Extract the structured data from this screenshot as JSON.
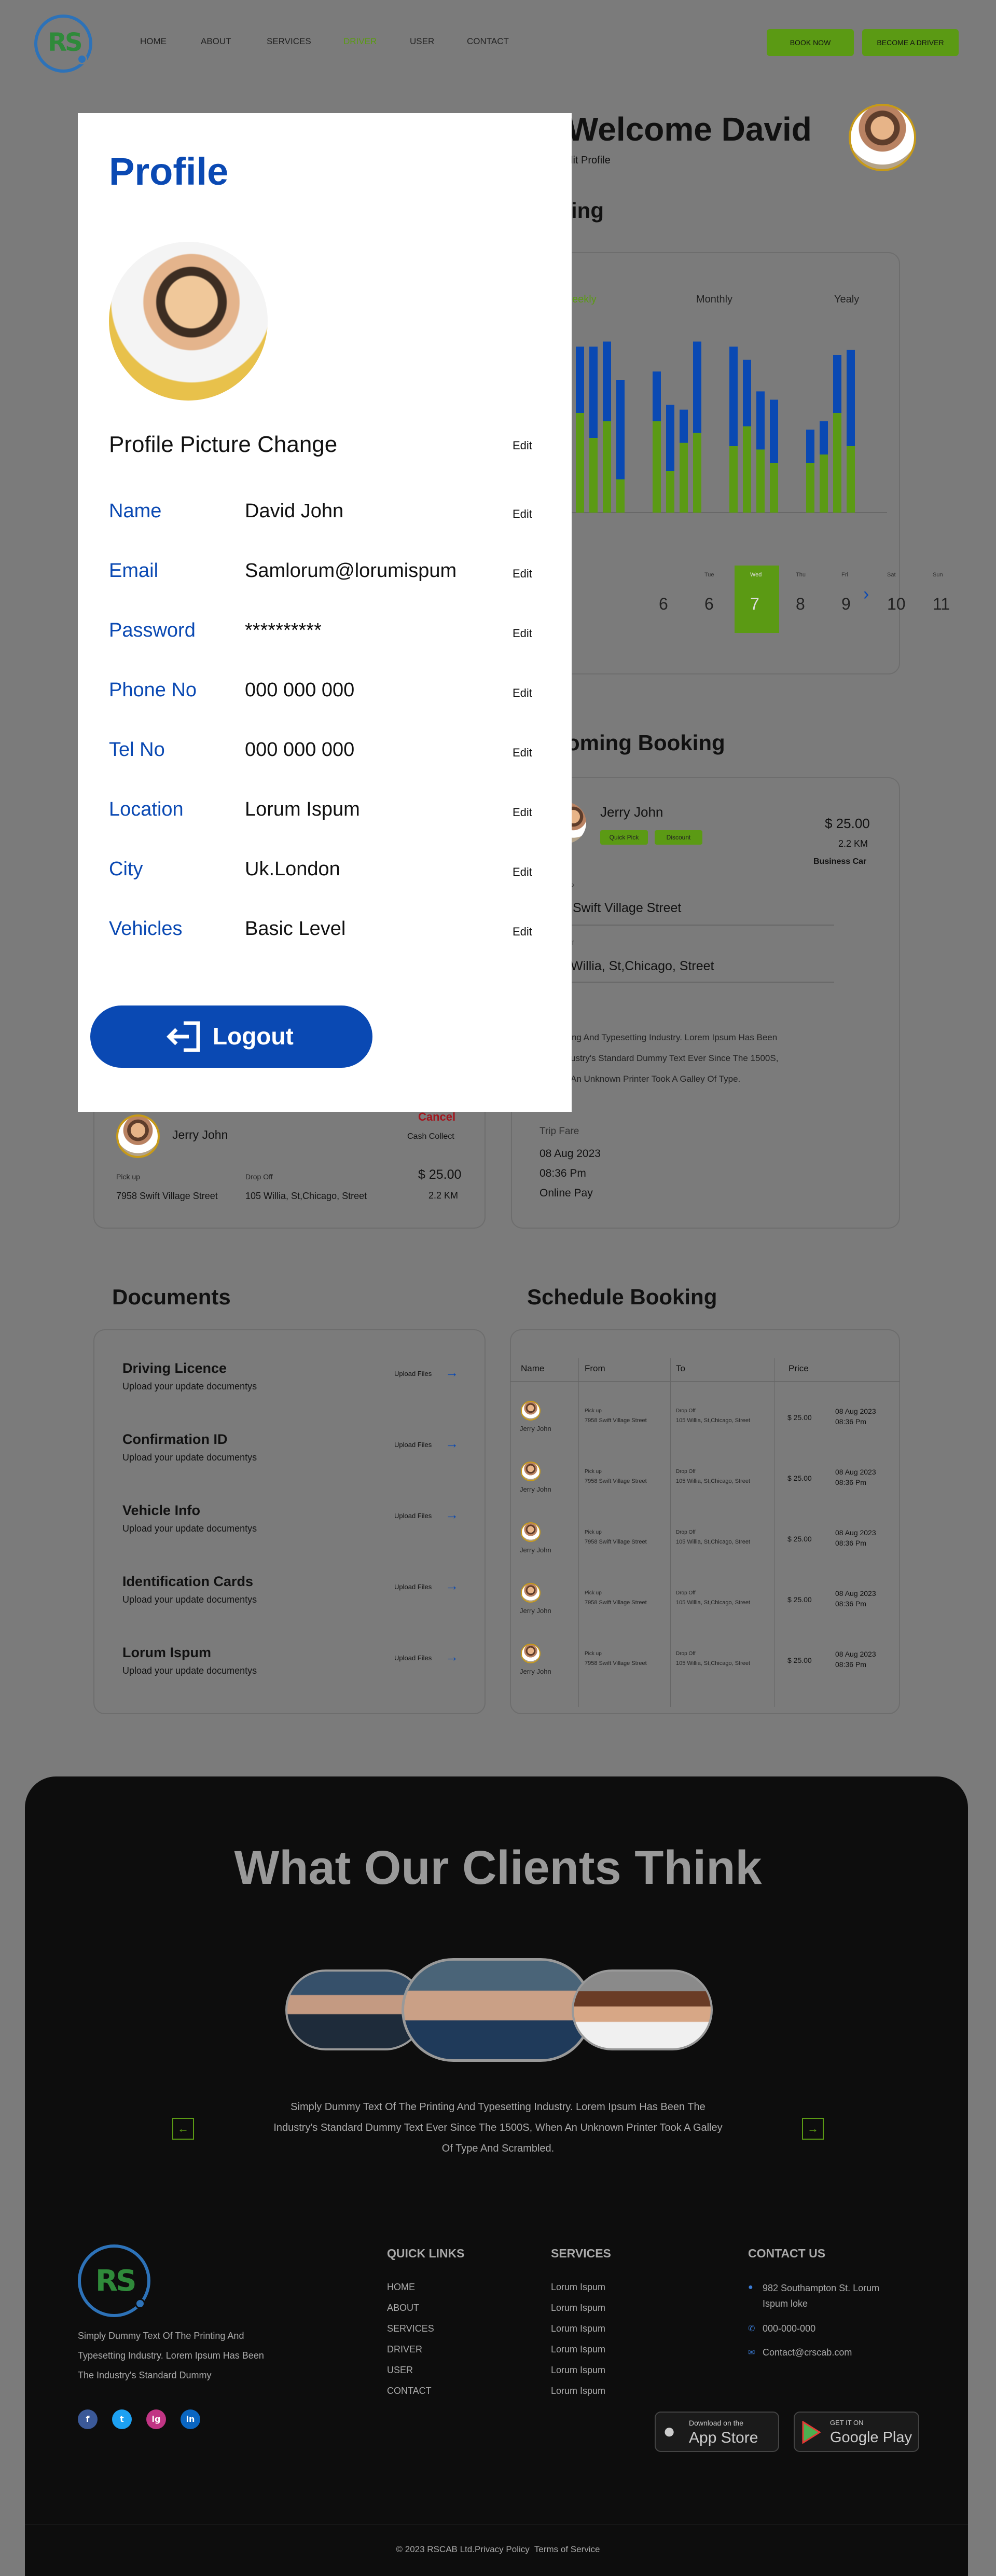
{
  "header": {
    "nav": [
      "HOME",
      "ABOUT",
      "SERVICES",
      "DRIVER",
      "USER",
      "CONTACT"
    ],
    "book_now": "BOOK NOW",
    "become_driver": "BECOME A DRIVER"
  },
  "welcome": {
    "title": "Welcome David",
    "edit_profile": "Edit Profile"
  },
  "earnings": {
    "title": "ing",
    "tabs": [
      "eekly",
      "Monthly",
      "Yealy"
    ],
    "days": [
      {
        "label": "",
        "num": "6"
      },
      {
        "label": "Tue",
        "num": "6"
      },
      {
        "label": "Wed",
        "num": "7"
      },
      {
        "label": "Thu",
        "num": "8"
      },
      {
        "label": "Fri",
        "num": "9"
      },
      {
        "label": "Sat",
        "num": "10"
      },
      {
        "label": "Sun",
        "num": "11"
      }
    ]
  },
  "chart_data": {
    "type": "bar",
    "series_colors": {
      "green": "#5b9a14",
      "blue": "#0a49b3"
    },
    "groups": [
      {
        "bars": [
          [
            60,
            40
          ],
          [
            45,
            55
          ],
          [
            55,
            48
          ],
          [
            20,
            60
          ]
        ]
      },
      {
        "bars": [
          [
            55,
            30
          ],
          [
            25,
            40
          ],
          [
            42,
            20
          ],
          [
            48,
            55
          ]
        ]
      },
      {
        "bars": [
          [
            40,
            60
          ],
          [
            52,
            40
          ],
          [
            38,
            35
          ],
          [
            30,
            38
          ]
        ]
      },
      {
        "bars": [
          [
            30,
            20
          ],
          [
            35,
            20
          ],
          [
            60,
            35
          ],
          [
            40,
            58
          ]
        ]
      }
    ]
  },
  "upcoming": {
    "title": "oming Booking",
    "name": "Jerry John",
    "price": "$ 25.00",
    "distance": "2.2 KM",
    "car": "Business Car",
    "badge1": "Quick Pick",
    "badge2": "Discount",
    "pickup": "Swift Village Street",
    "pickup_label": "p",
    "drop_label": "ff",
    "dropoff": "Willia, St,Chicago, Street",
    "desc": [
      "nting And Typesetting Industry. Lorem Ipsum Has Been",
      "ustry's Standard Dummy Text Ever Since The 1500S,",
      "An Unknown Printer Took A Galley Of Type."
    ],
    "trip_fare": "Trip Fare",
    "date": "08 Aug 2023",
    "time": "08:36 Pm",
    "pay": "Online Pay"
  },
  "recent": {
    "cancel": "Cancel",
    "cash": "Cash Collect",
    "name": "Jerry John",
    "pickup_label": "Pick up",
    "drop_label": "Drop Off",
    "pickup": "7958 Swift Village Street",
    "dropoff": "105 Willia, St,Chicago, Street",
    "price": "$ 25.00",
    "distance": "2.2 KM"
  },
  "profile": {
    "title": "Profile",
    "pic_change": "Profile Picture Change",
    "edit": "Edit",
    "rows": [
      {
        "label": "Name",
        "value": "David John"
      },
      {
        "label": "Email",
        "value": "Samlorum@lorumispum"
      },
      {
        "label": "Password",
        "value": "**********"
      },
      {
        "label": "Phone No",
        "value": "000 000 000"
      },
      {
        "label": "Tel No",
        "value": "000 000 000"
      },
      {
        "label": "Location",
        "value": "Lorum Ispum"
      },
      {
        "label": "City",
        "value": "Uk.London"
      },
      {
        "label": "Vehicles",
        "value": "Basic Level"
      }
    ],
    "logout": "Logout"
  },
  "documents": {
    "title": "Documents",
    "upload": "Upload Files",
    "items": [
      {
        "title": "Driving Licence",
        "sub": "Upload your update documentys"
      },
      {
        "title": "Confirmation ID",
        "sub": "Upload your update documentys"
      },
      {
        "title": "Vehicle Info",
        "sub": "Upload your update documentys"
      },
      {
        "title": "Identification Cards",
        "sub": "Upload your update documentys"
      },
      {
        "title": "Lorum Ispum",
        "sub": "Upload your update documentys"
      }
    ]
  },
  "schedule": {
    "title": "Schedule Booking",
    "headers": [
      "Name",
      "From",
      "To",
      "Price"
    ],
    "row": {
      "name": "Jerry John",
      "pick_label": "Pick up",
      "from": "7958 Swift Village Street",
      "drop_label": "Drop Off",
      "to": "105 Willia, St,Chicago, Street",
      "price": "$ 25.00",
      "date": "08 Aug 2023",
      "time": "08:36 Pm"
    }
  },
  "testimonials": {
    "title": "What Our Clients Think",
    "text": [
      "Simply Dummy Text Of The Printing And Typesetting Industry. Lorem Ipsum Has Been The",
      "Industry's Standard Dummy Text Ever Since The 1500S, When An Unknown Printer Took A Galley",
      "Of Type And Scrambled."
    ]
  },
  "footer": {
    "about": [
      "Simply Dummy Text Of The Printing And",
      "Typesetting Industry. Lorem Ipsum Has Been",
      "The Industry's Standard Dummy"
    ],
    "quick_title": "QUICK LINKS",
    "quick": [
      "HOME",
      "ABOUT",
      "SERVICES",
      "DRIVER",
      "USER",
      "CONTACT"
    ],
    "services_title": "SERVICES",
    "services": [
      "Lorum Ispum",
      "Lorum Ispum",
      "Lorum Ispum",
      "Lorum Ispum",
      "Lorum Ispum",
      "Lorum Ispum"
    ],
    "contact_title": "CONTACT US",
    "address": [
      "982 Southampton St. Lorum",
      "Ispum loke"
    ],
    "phone": "000-000-000",
    "email": "Contact@crscab.com",
    "app_small": "Download on the",
    "app_big": "App Store",
    "gp_small": "GET IT ON",
    "gp_big": "Google Play",
    "copyright": "© 2023 RSCAB Ltd.Privacy Policy  Terms of Service",
    "social": [
      "f",
      "t",
      "ig",
      "in"
    ]
  }
}
